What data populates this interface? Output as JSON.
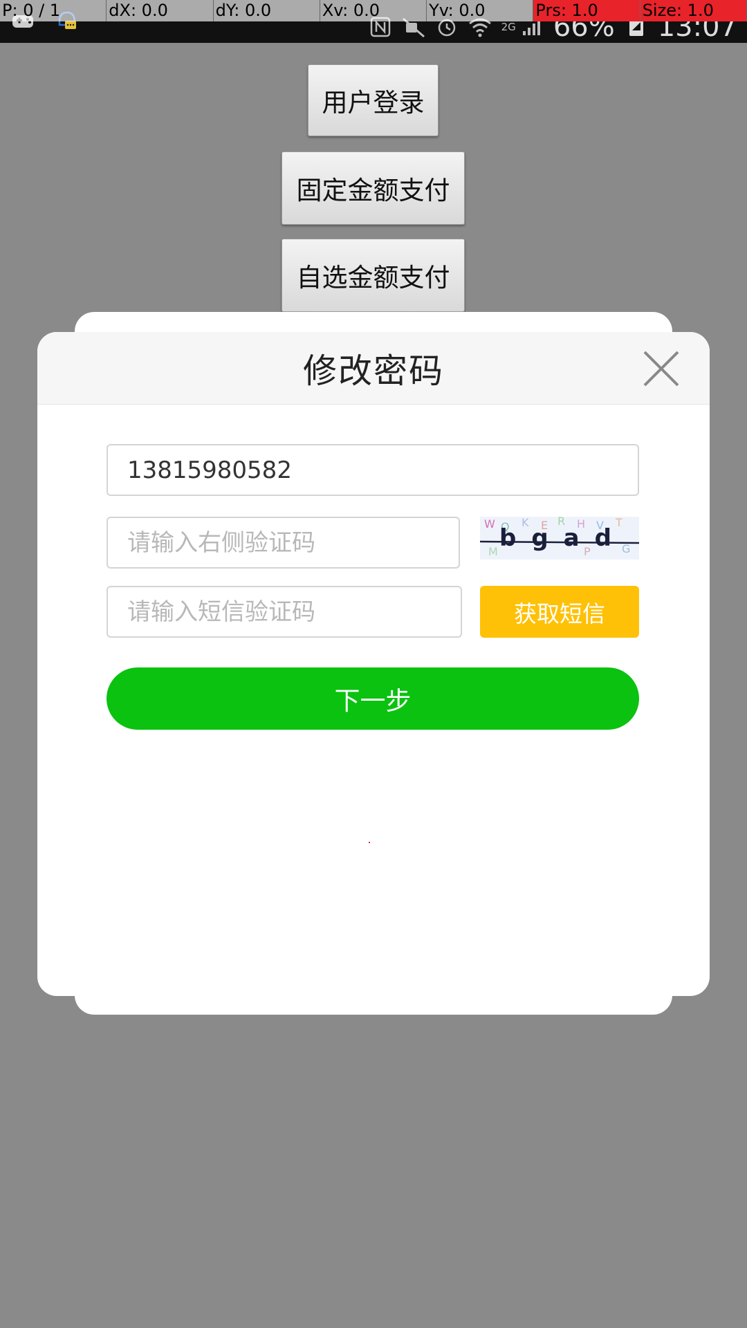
{
  "pointer_overlay": {
    "p": "P: 0 / 1",
    "dx": "dX: 0.0",
    "dy": "dY: 0.0",
    "xv": "Xv: 0.0",
    "yv": "Yv: 0.0",
    "prs": "Prs: 1.0",
    "size": "Size: 1.0"
  },
  "status_bar": {
    "network": "2G",
    "battery": "66%",
    "time": "13:07",
    "icons": [
      "game-icon",
      "notification-icon",
      "nfc-icon",
      "mute-icon",
      "alarm-icon",
      "wifi-icon",
      "signal-icon",
      "battery-icon"
    ]
  },
  "background_buttons": {
    "login": "用户登录",
    "fixed_pay": "固定金额支付",
    "custom_pay": "自选金额支付"
  },
  "dialog": {
    "title": "修改密码",
    "phone_value": "13815980582",
    "captcha_placeholder": "请输入右侧验证码",
    "captcha_text": "bgad",
    "sms_placeholder": "请输入短信验证码",
    "sms_button": "获取短信",
    "next_button": "下一步"
  },
  "colors": {
    "sms_button": "#ffc107",
    "next_button": "#0ac20f",
    "overlay": "#8a8a8a"
  }
}
